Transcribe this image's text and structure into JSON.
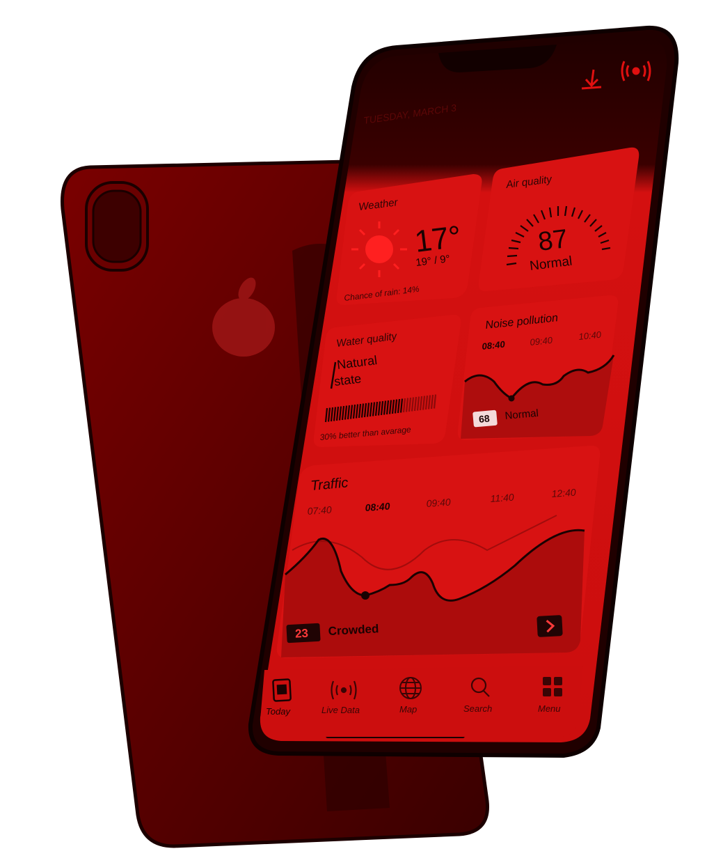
{
  "colors": {
    "accent": "#e01010",
    "card": "#d81212",
    "screen_dark": "#250000",
    "text_dark": "#1a0202",
    "badge_bg": "#200404",
    "badge_text": "#ff3a3a"
  },
  "header": {
    "date": "TUESDAY, MARCH 3",
    "download_icon": "download-icon",
    "live_icon": "broadcast-icon"
  },
  "weather": {
    "title": "Weather",
    "temp": "17°",
    "range": "19° / 9°",
    "rain": "Chance of rain: 14%",
    "icon": "sun-icon"
  },
  "air": {
    "title": "Air quality",
    "value": "87",
    "status": "Normal"
  },
  "water": {
    "title": "Water quality",
    "state": [
      "Natural",
      "state"
    ],
    "level": 0.7,
    "note": "30% better than avarage"
  },
  "noise": {
    "title": "Noise pollution",
    "times": [
      "08:40",
      "09:40",
      "10:40"
    ],
    "value": "68",
    "status": "Normal"
  },
  "traffic": {
    "title": "Traffic",
    "times": [
      "07:40",
      "08:40",
      "09:40",
      "11:40",
      "12:40"
    ],
    "value": "23",
    "status": "Crowded",
    "arrow_icon": "chevron-right-icon"
  },
  "tabbar": [
    {
      "label": "Today",
      "icon": "document-icon"
    },
    {
      "label": "Live Data",
      "icon": "broadcast-icon"
    },
    {
      "label": "Map",
      "icon": "globe-icon"
    },
    {
      "label": "Search",
      "icon": "search-icon"
    },
    {
      "label": "Menu",
      "icon": "grid-icon"
    }
  ]
}
